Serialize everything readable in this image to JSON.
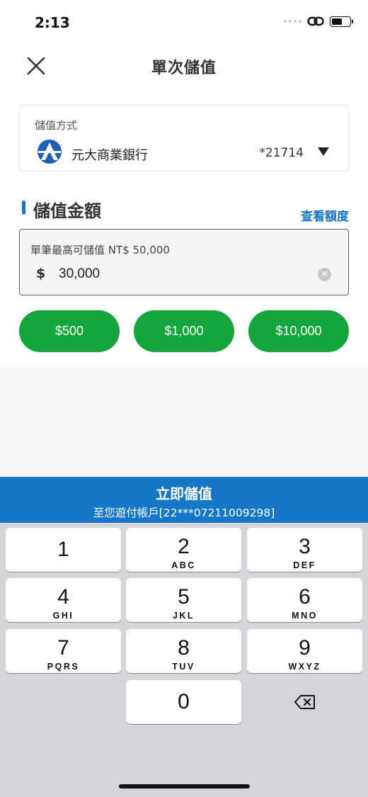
{
  "status_bar": {
    "time": "2:13"
  },
  "header": {
    "title": "單次儲值"
  },
  "payment_method": {
    "label": "儲值方式",
    "bank_name": "元大商業銀行",
    "account_suffix": "*21714"
  },
  "amount_section": {
    "title": "儲值金額",
    "quota_link": "查看額度",
    "hint": "單筆最高可儲值 NT$ 50,000",
    "currency_symbol": "$",
    "value": "30,000"
  },
  "preset_amounts": [
    "$500",
    "$1,000",
    "$10,000"
  ],
  "submit": {
    "title": "立即儲值",
    "subtitle": "至您遊付帳戶[22***07211009298]"
  },
  "keypad": {
    "keys": [
      {
        "num": "1",
        "letters": ""
      },
      {
        "num": "2",
        "letters": "ABC"
      },
      {
        "num": "3",
        "letters": "DEF"
      },
      {
        "num": "4",
        "letters": "GHI"
      },
      {
        "num": "5",
        "letters": "JKL"
      },
      {
        "num": "6",
        "letters": "MNO"
      },
      {
        "num": "7",
        "letters": "PQRS"
      },
      {
        "num": "8",
        "letters": "TUV"
      },
      {
        "num": "9",
        "letters": "WXYZ"
      },
      {
        "num": "0",
        "letters": ""
      }
    ]
  },
  "colors": {
    "accent_blue": "#1677c6",
    "link_blue": "#1a73c7",
    "preset_green": "#14a63c",
    "keyboard_bg": "#d3d5db"
  }
}
